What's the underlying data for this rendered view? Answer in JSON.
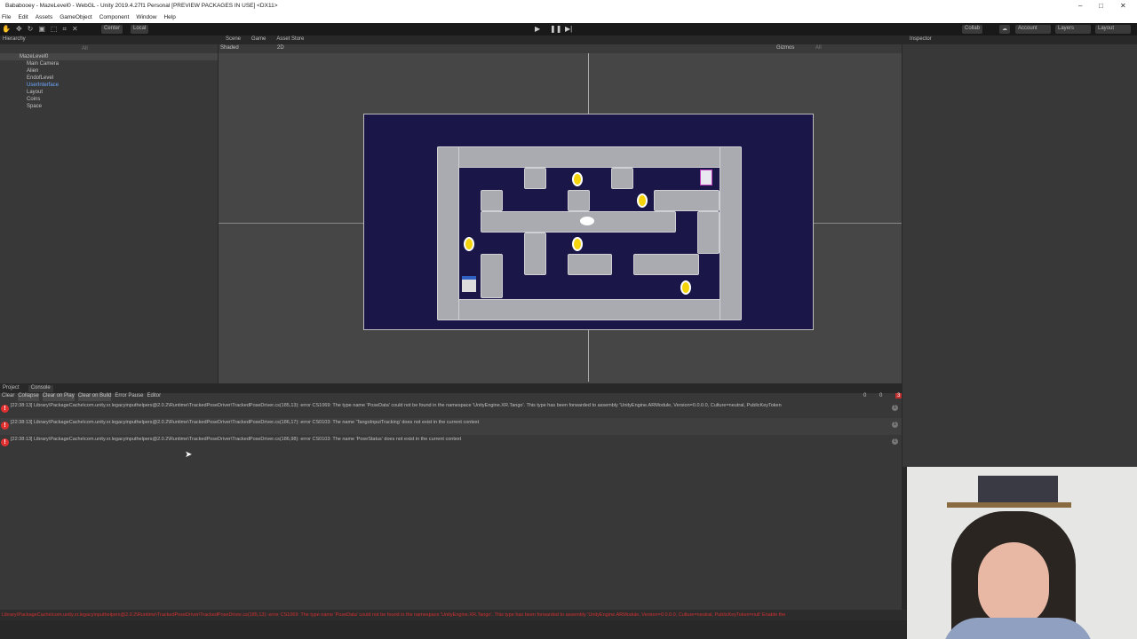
{
  "window": {
    "title": "Bababooey - MazeLevel0 - WebGL - Unity 2019.4.27f1 Personal [PREVIEW PACKAGES IN USE] <DX11>"
  },
  "menu": [
    "File",
    "Edit",
    "Assets",
    "GameObject",
    "Component",
    "Window",
    "Help"
  ],
  "toolbar": {
    "pivot": "Center",
    "space": "Local",
    "collab": "Collab",
    "account": "Account",
    "layers": "Layers",
    "layout": "Layout"
  },
  "hierarchy": {
    "tab": "Hierarchy",
    "search_placeholder": "All",
    "root": "MazeLevel0",
    "items": [
      "Main Camera",
      "Alien",
      "EndofLevel",
      "UserInterface",
      "Layout",
      "Coins",
      "Space"
    ]
  },
  "scene": {
    "tabs": [
      "Scene",
      "Game",
      "Asset Store"
    ],
    "shading": "Shaded",
    "mode2d": "2D",
    "gizmos": "Gizmos",
    "search_placeholder": "All",
    "hidden_count": "0"
  },
  "inspector": {
    "tab": "Inspector"
  },
  "console": {
    "tabs": [
      "Project",
      "Console"
    ],
    "buttons": [
      "Clear",
      "Collapse",
      "Clear on Play",
      "Clear on Build",
      "Error Pause",
      "Editor"
    ],
    "counts": {
      "info": "0",
      "warn": "0",
      "error": "3"
    },
    "rows": [
      {
        "text": "[22:38:13] Library\\PackageCache\\com.unity.xr.legacyinputhelpers@2.0.2\\Runtime\\TrackedPoseDriver\\TrackedPoseDriver.cs(185,13): error CS1069: The type name 'PoseData' could not be found in the namespace 'UnityEngine.XR.Tango'. This type has been forwarded to assembly 'UnityEngine.ARModule, Version=0.0.0.0, Culture=neutral, PublicKeyToken",
        "count": "1"
      },
      {
        "text": "[22:38:13] Library\\PackageCache\\com.unity.xr.legacyinputhelpers@2.0.2\\Runtime\\TrackedPoseDriver\\TrackedPoseDriver.cs(186,17): error CS0103: The name 'TangoInputTracking' does not exist in the current context",
        "count": "1"
      },
      {
        "text": "[22:38:13] Library\\PackageCache\\com.unity.xr.legacyinputhelpers@2.0.2\\Runtime\\TrackedPoseDriver\\TrackedPoseDriver.cs(186,98): error CS0103: The name 'PoseStatus' does not exist in the current context",
        "count": "1"
      }
    ]
  },
  "status": {
    "text": "Library\\PackageCache\\com.unity.xr.legacyinputhelpers@2.0.2\\Runtime\\TrackedPoseDriver\\TrackedPoseDriver.cs(185,13): error CS1069: The type name 'PoseData' could not be found in the namespace 'UnityEngine.XR.Tango'. This type has been forwarded to assembly 'UnityEngine.ARModule, Version=0.0.0.0, Culture=neutral, PublicKeyToken=null' Enable the"
  },
  "colors": {
    "error": "#e03030",
    "selected_item": "#6fa8ff",
    "game_bg": "#1a1648"
  }
}
